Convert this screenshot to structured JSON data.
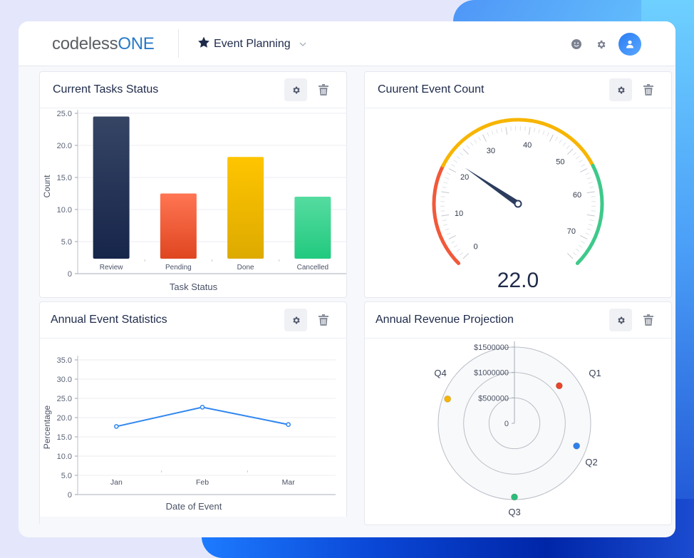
{
  "app": {
    "logo_part1": "codeless",
    "logo_part2": "ONE",
    "app_name": "Event Planning",
    "icons": [
      "star-icon",
      "chevron-down-icon",
      "smiley-icon",
      "gear-icon",
      "user-icon"
    ]
  },
  "colors": {
    "brand_blue": "#2979c8",
    "title_navy": "#1e2a4a",
    "review": "#1e2a4a",
    "pending": "#ef5a35",
    "done": "#f7bb00",
    "cancelled": "#37d08c",
    "line": "#2f86f0"
  },
  "cards": {
    "tasks": {
      "title": "Current Tasks Status"
    },
    "event_count": {
      "title": "Cuurent Event Count"
    },
    "annual_stats": {
      "title": "Annual Event Statistics"
    },
    "revenue": {
      "title": "Annual Revenue Projection"
    }
  },
  "chart_data": [
    {
      "type": "bar",
      "title": "Current Tasks Status",
      "xlabel": "Task Status",
      "ylabel": "Count",
      "categories": [
        "Review",
        "Pending",
        "Done",
        "Cancelled"
      ],
      "values": [
        24.5,
        12.5,
        18.2,
        12.0
      ],
      "ylim": [
        0,
        25
      ],
      "yticks": [
        "0",
        "5.0",
        "10.0",
        "15.0",
        "20.0",
        "25.0"
      ],
      "grid": true
    },
    {
      "type": "gauge",
      "title": "Cuurent Event Count",
      "value": 22.0,
      "value_label": "22.0",
      "range": [
        0,
        75
      ],
      "tick_labels": [
        "0",
        "10",
        "20",
        "30",
        "40",
        "50",
        "60",
        "70"
      ],
      "bands": [
        {
          "from": 0,
          "to": 20,
          "color": "#f1593a"
        },
        {
          "from": 20,
          "to": 55,
          "color": "#f7b500"
        },
        {
          "from": 55,
          "to": 75,
          "color": "#3ec98a"
        }
      ]
    },
    {
      "type": "line",
      "title": "Annual Event Statistics",
      "xlabel": "Date of Event",
      "ylabel": "Percentage",
      "categories": [
        "Jan",
        "Feb",
        "Mar"
      ],
      "values": [
        17.7,
        22.7,
        18.2
      ],
      "ylim": [
        0,
        35
      ],
      "yticks": [
        "0",
        "5.0",
        "10.0",
        "15.0",
        "20.0",
        "25.0",
        "30.0",
        "35.0"
      ],
      "grid": true
    },
    {
      "type": "scatter",
      "subtype": "polar",
      "title": "Annual Revenue Projection",
      "categories": [
        "Q1",
        "Q2",
        "Q3",
        "Q4"
      ],
      "values": [
        1150000,
        1300000,
        1450000,
        1400000
      ],
      "angles_deg": [
        50,
        110,
        180,
        290
      ],
      "colors": [
        "#e8462a",
        "#2f80ed",
        "#2dbd7a",
        "#f7b500"
      ],
      "rlim": [
        0,
        1500000
      ],
      "rticks": [
        "0",
        "$500000",
        "$1000000",
        "$1500000"
      ]
    }
  ]
}
